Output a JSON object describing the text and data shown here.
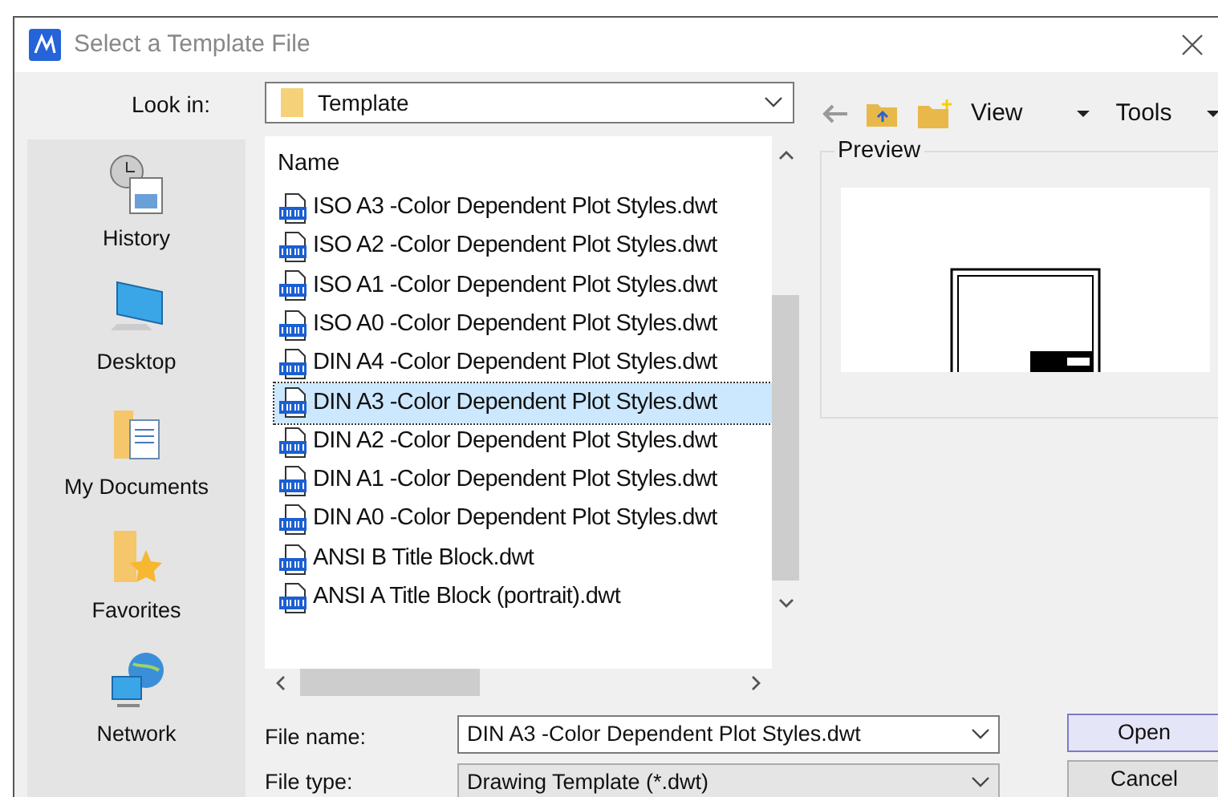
{
  "window": {
    "title": "Select a Template File"
  },
  "look_in": {
    "label": "Look in:",
    "value": "Template"
  },
  "toolbar": {
    "view": "View",
    "tools": "Tools"
  },
  "places": [
    {
      "label": "History",
      "kind": "history"
    },
    {
      "label": "Desktop",
      "kind": "desktop"
    },
    {
      "label": "My Documents",
      "kind": "documents"
    },
    {
      "label": "Favorites",
      "kind": "favorites"
    },
    {
      "label": "Network",
      "kind": "network"
    }
  ],
  "file_list": {
    "column": "Name",
    "items": [
      {
        "name": "ISO A3 -Color Dependent Plot Styles.dwt",
        "selected": false
      },
      {
        "name": "ISO A2 -Color Dependent Plot Styles.dwt",
        "selected": false
      },
      {
        "name": "ISO A1 -Color Dependent Plot Styles.dwt",
        "selected": false
      },
      {
        "name": "ISO A0 -Color Dependent Plot Styles.dwt",
        "selected": false
      },
      {
        "name": "DIN A4 -Color Dependent Plot Styles.dwt",
        "selected": false
      },
      {
        "name": "DIN A3 -Color Dependent Plot Styles.dwt",
        "selected": true
      },
      {
        "name": "DIN A2 -Color Dependent Plot Styles.dwt",
        "selected": false
      },
      {
        "name": "DIN A1 -Color Dependent Plot Styles.dwt",
        "selected": false
      },
      {
        "name": "DIN A0 -Color Dependent Plot Styles.dwt",
        "selected": false
      },
      {
        "name": "ANSI B Title Block.dwt",
        "selected": false
      },
      {
        "name": "ANSI A Title Block (portrait).dwt",
        "selected": false
      }
    ]
  },
  "preview": {
    "label": "Preview"
  },
  "file_name": {
    "label": "File name:",
    "value": "DIN A3 -Color Dependent Plot Styles.dwt"
  },
  "file_type": {
    "label": "File type:",
    "value": "Drawing Template (*.dwt)"
  },
  "buttons": [
    "Open",
    "Cancel"
  ]
}
